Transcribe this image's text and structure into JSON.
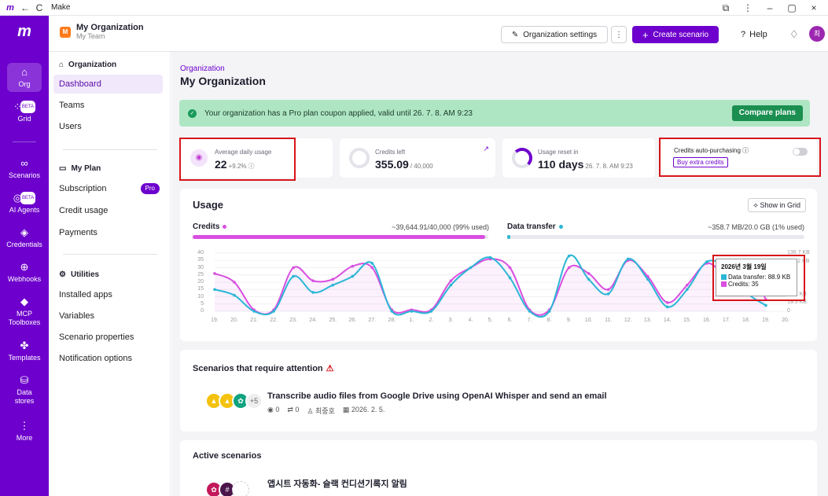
{
  "window": {
    "title": "Make"
  },
  "header": {
    "org_name": "My Organization",
    "team_name": "My Team",
    "org_initial": "M",
    "org_settings_label": "Organization settings",
    "more_label": "⋮",
    "create_label": "Create scenario",
    "help_label": "Help",
    "user_initial": "최"
  },
  "rail": {
    "items": [
      {
        "label": "Org",
        "icon": "home-icon"
      },
      {
        "label": "Grid",
        "badge": "BETA",
        "icon": "grid-icon"
      },
      {
        "label": "Scenarios",
        "icon": "share-icon"
      },
      {
        "label": "AI Agents",
        "badge": "BETA",
        "icon": "ai-agent-icon"
      },
      {
        "label": "Credentials",
        "icon": "shield-icon"
      },
      {
        "label": "Webhooks",
        "icon": "globe-icon"
      },
      {
        "label": "MCP Toolboxes",
        "icon": "mcp-icon"
      },
      {
        "label": "Templates",
        "icon": "puzzle-icon"
      },
      {
        "label": "Data stores",
        "icon": "database-icon"
      },
      {
        "label": "More",
        "icon": "more-icon"
      }
    ]
  },
  "subnav": {
    "org_section": "Organization",
    "org_links": [
      "Dashboard",
      "Teams",
      "Users"
    ],
    "plan_section": "My Plan",
    "plan_links": [
      "Subscription",
      "Credit usage",
      "Payments"
    ],
    "pro_badge": "Pro",
    "util_section": "Utilities",
    "util_links": [
      "Installed apps",
      "Variables",
      "Scenario properties",
      "Notification options"
    ]
  },
  "page": {
    "breadcrumb": "Organization",
    "title": "My Organization"
  },
  "banner": {
    "text": "Your organization has a Pro plan coupon applied, valid until 26. 7. 8. AM 9:23",
    "button": "Compare plans"
  },
  "stats": {
    "avg_label": "Average daily usage",
    "avg_value": "22",
    "avg_change": "+9.2%",
    "credits_label": "Credits left",
    "credits_value": "355.09",
    "credits_total": "/ 40,000",
    "reset_label": "Usage reset in",
    "reset_value": "110 days",
    "reset_date": "26. 7. 8. AM 9:23",
    "auto_label": "Credits auto-purchasing",
    "auto_enabled": false,
    "buy_label": "Buy extra credits"
  },
  "usage": {
    "title": "Usage",
    "show_in_grid": "Show in Grid",
    "credits_label": "Credits",
    "credits_used": "~39,644.91/40,000 (99% used)",
    "credits_fraction": 0.99,
    "transfer_label": "Data transfer",
    "transfer_used": "~358.7 MB/20.0 GB (1% used)",
    "transfer_fraction": 0.01,
    "colors": {
      "credits": "#d94fe0",
      "transfer": "#2bb6d6"
    }
  },
  "chart_data": {
    "type": "line",
    "x": [
      "19.",
      "20.",
      "21.",
      "22.",
      "23.",
      "24.",
      "25.",
      "26.",
      "27.",
      "28.",
      "1.",
      "2.",
      "3.",
      "4.",
      "5.",
      "6.",
      "7.",
      "8.",
      "9.",
      "10.",
      "11.",
      "12.",
      "13.",
      "14.",
      "15.",
      "16.",
      "17.",
      "18.",
      "19.",
      "20."
    ],
    "y_ticks": [
      "0",
      "5",
      "10",
      "15",
      "20",
      "25",
      "30",
      "35",
      "40"
    ],
    "ylim": [
      0,
      40
    ],
    "y2_ticks": [
      "136.7 KB",
      "117.2 KB",
      "KB",
      "KB",
      "KB",
      "39.1 KB",
      "19.5 KB",
      "0"
    ],
    "series": [
      {
        "name": "Credits",
        "values": [
          26,
          20,
          1,
          1,
          30,
          21,
          22,
          31,
          30,
          1,
          1,
          1,
          21,
          30,
          36,
          30,
          1,
          1,
          30,
          26,
          15,
          35,
          24,
          6,
          18,
          33,
          26,
          35,
          8
        ]
      },
      {
        "name": "Data transfer",
        "values": [
          15,
          11,
          0,
          0,
          24,
          13,
          18,
          24,
          33,
          0,
          0,
          0,
          18,
          30,
          37,
          23,
          0,
          0,
          38,
          22,
          12,
          36,
          22,
          3,
          15,
          34,
          30,
          13,
          4
        ]
      }
    ],
    "tooltip": {
      "date": "2026년 3월 19일",
      "transfer": "Data transfer: 88.9 KB",
      "credits": "Credits: 35"
    }
  },
  "attention": {
    "title": "Scenarios that require attention",
    "more_count": "+5",
    "scenario": {
      "name": "Transcribe audio files from Google Drive using OpenAI Whisper and send an email",
      "views": "0",
      "ops": "0",
      "owner": "최중호",
      "date": "2026. 2. 5."
    }
  },
  "active": {
    "title": "Active scenarios",
    "scenario_name": "앱시트 자동화- 슬랙 컨디션기록지 알림"
  }
}
